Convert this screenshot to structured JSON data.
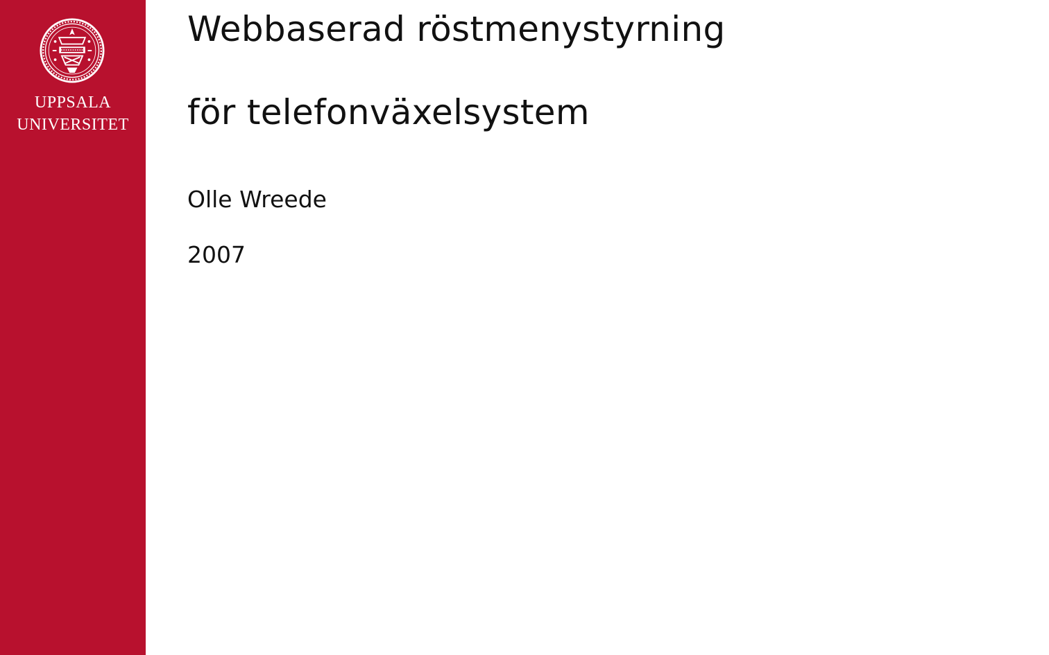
{
  "branding": {
    "university_line1": "UPPSALA",
    "university_line2": "UNIVERSITET",
    "sidebar_color": "#b8112e",
    "seal_icon": "university-seal-icon"
  },
  "document": {
    "title_line1": "Webbaserad röstmenystyrning",
    "title_line2": "för telefonväxelsystem",
    "author": "Olle Wreede",
    "year": "2007"
  }
}
